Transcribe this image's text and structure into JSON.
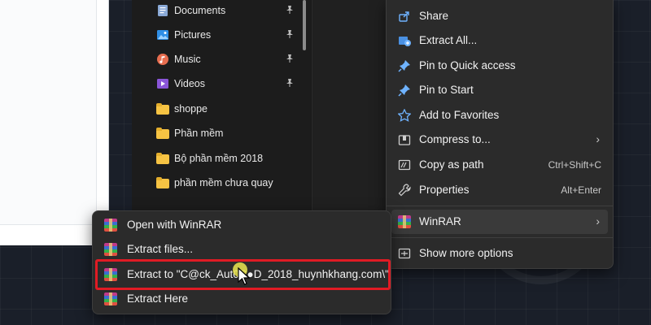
{
  "explorer": {
    "nav_items": [
      {
        "label": "Documents",
        "icon": "documents-icon",
        "pinned": true
      },
      {
        "label": "Pictures",
        "icon": "pictures-icon",
        "pinned": true
      },
      {
        "label": "Music",
        "icon": "music-icon",
        "pinned": true
      },
      {
        "label": "Videos",
        "icon": "videos-icon",
        "pinned": true
      },
      {
        "label": "shoppe",
        "icon": "folder-icon",
        "pinned": false
      },
      {
        "label": "Phần mềm",
        "icon": "folder-icon",
        "pinned": false
      },
      {
        "label": "Bộ phần mềm 2018",
        "icon": "folder-icon",
        "pinned": false
      },
      {
        "label": "phần mềm chưa quay",
        "icon": "folder-icon",
        "pinned": false
      }
    ]
  },
  "context_menu": {
    "items": [
      {
        "label": "Share",
        "icon": "share-icon"
      },
      {
        "label": "Extract All...",
        "icon": "extract-all-icon"
      },
      {
        "label": "Pin to Quick access",
        "icon": "pin-icon"
      },
      {
        "label": "Pin to Start",
        "icon": "pin-icon"
      },
      {
        "label": "Add to Favorites",
        "icon": "star-icon"
      },
      {
        "label": "Compress to...",
        "icon": "compress-icon",
        "arrow": "›"
      },
      {
        "label": "Copy as path",
        "icon": "copy-path-icon",
        "shortcut": "Ctrl+Shift+C"
      },
      {
        "label": "Properties",
        "icon": "wrench-icon",
        "shortcut": "Alt+Enter"
      },
      {
        "label": "WinRAR",
        "icon": "winrar-icon",
        "arrow": "›"
      },
      {
        "label": "Show more options",
        "icon": "show-more-icon"
      }
    ]
  },
  "winrar_submenu": {
    "items": [
      {
        "label": "Open with WinRAR",
        "icon": "winrar-icon"
      },
      {
        "label": "Extract files...",
        "icon": "winrar-icon"
      },
      {
        "label": "Extract to \"C@ck_Aut0C●D_2018_huynhkhang.com\\\"",
        "icon": "winrar-icon"
      },
      {
        "label": "Extract Here",
        "icon": "winrar-icon"
      }
    ]
  },
  "colors": {
    "highlight": "#e01b24",
    "menu_bg": "#2b2b2b",
    "cursor_halo": "#ebe650"
  }
}
